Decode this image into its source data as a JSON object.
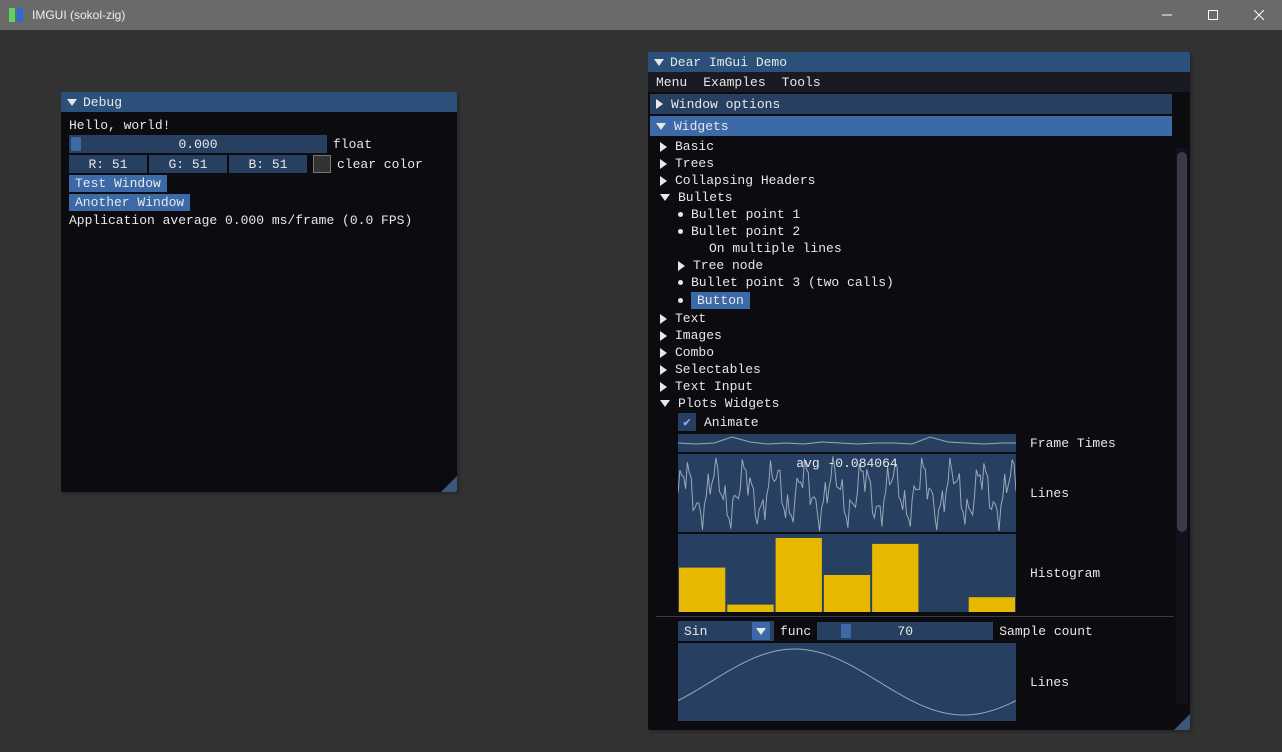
{
  "os": {
    "title": "IMGUI (sokol-zig)"
  },
  "debug": {
    "title": "Debug",
    "hello": "Hello, world!",
    "float_value": "0.000",
    "float_label": "float",
    "color": {
      "r": "R: 51",
      "g": "G: 51",
      "b": "B: 51",
      "hex": "#333333"
    },
    "clear_label": "clear color",
    "btn_test": "Test Window",
    "btn_another": "Another Window",
    "stats": "Application average 0.000 ms/frame (0.0 FPS)"
  },
  "demo": {
    "title": "Dear ImGui Demo",
    "menu": {
      "m1": "Menu",
      "m2": "Examples",
      "m3": "Tools"
    },
    "window_options": "Window options",
    "widgets": "Widgets",
    "basic": "Basic",
    "trees": "Trees",
    "ch": "Collapsing Headers",
    "bullets": "Bullets",
    "b1": "Bullet point 1",
    "b2": "Bullet point 2",
    "b2b": "On multiple lines",
    "treenode": "Tree node",
    "b3": "Bullet point 3 (two calls)",
    "bbtn": "Button",
    "text": "Text",
    "images": "Images",
    "combo": "Combo",
    "selectables": "Selectables",
    "textinput": "Text Input",
    "plotswidgets": "Plots Widgets",
    "animate": "Animate",
    "frametimes_label": "Frame Times",
    "lines_label": "Lines",
    "lines_overlay": "avg -0.084064",
    "histogram_label": "Histogram",
    "func_selected": "Sin",
    "func_label": "func",
    "sample_value": "70",
    "sample_label": "Sample count",
    "lines2_label": "Lines"
  },
  "chart_data": [
    {
      "type": "line",
      "title": "Frame Times",
      "x": [
        0,
        1,
        2,
        3,
        4,
        5,
        6,
        7,
        8,
        9,
        10,
        11,
        12,
        13,
        14,
        15,
        16,
        17,
        18,
        19
      ],
      "values": [
        0.52,
        0.48,
        0.5,
        0.85,
        0.6,
        0.45,
        0.5,
        0.48,
        0.55,
        0.5,
        0.46,
        0.5,
        0.49,
        0.47,
        0.86,
        0.62,
        0.5,
        0.48,
        0.5,
        0.49
      ],
      "ylim": [
        0,
        1
      ]
    },
    {
      "type": "line",
      "title": "Lines",
      "overlay": "avg -0.084064",
      "x_count": 90,
      "ylim": [
        -1,
        1
      ],
      "note": "noisy oscillation around zero"
    },
    {
      "type": "bar",
      "title": "Histogram",
      "categories": [
        "0",
        "1",
        "2",
        "3",
        "4",
        "5",
        "6"
      ],
      "values": [
        0.6,
        0.1,
        1.0,
        0.5,
        0.92,
        0.0,
        0.2
      ],
      "ylim": [
        0,
        1
      ]
    },
    {
      "type": "line",
      "title": "Lines (func)",
      "func": "Sin",
      "sample_count": 70,
      "ylim": [
        -1,
        1
      ]
    }
  ]
}
